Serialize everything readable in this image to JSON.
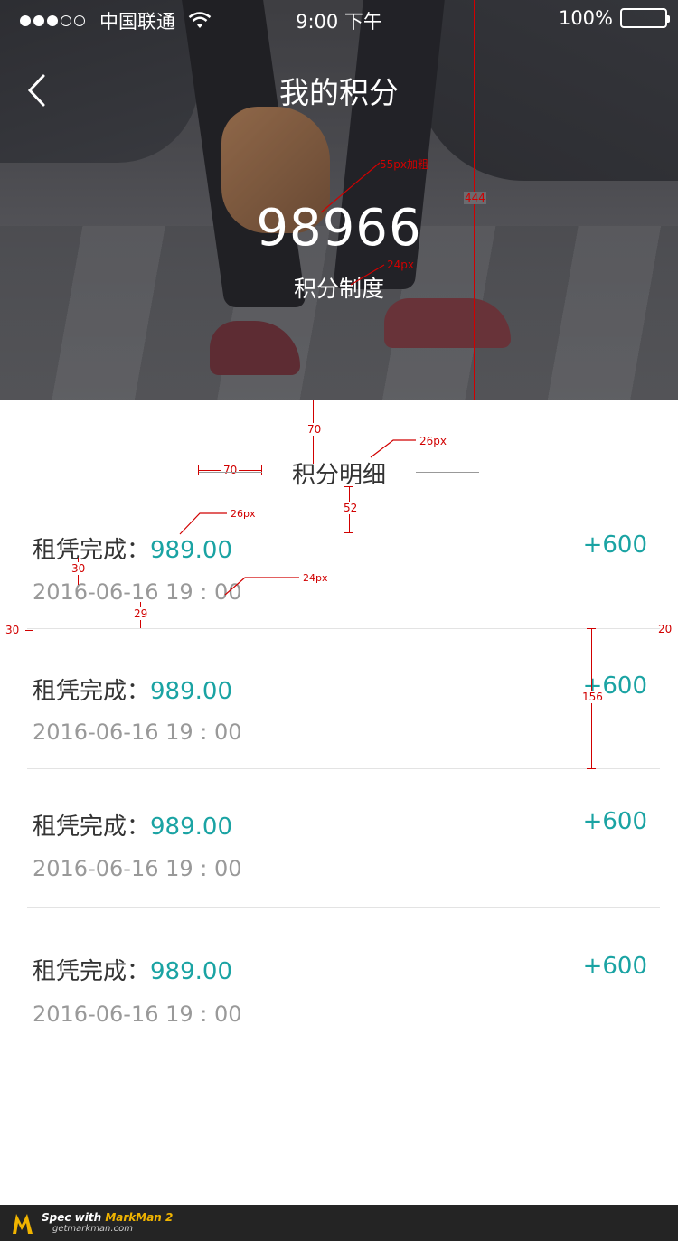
{
  "status_bar": {
    "carrier": "中国联通",
    "time": "9:00 下午",
    "battery": "100%"
  },
  "header": {
    "title": "我的积分",
    "points": "98966",
    "rules_link": "积分制度"
  },
  "section": {
    "title": "积分明细"
  },
  "records": [
    {
      "label": "租凭完成：",
      "amount": "989.00",
      "change": "+600",
      "datetime": "2016-06-16   19 : 00"
    },
    {
      "label": "租凭完成：",
      "amount": "989.00",
      "change": "+600",
      "datetime": "2016-06-16   19 : 00"
    },
    {
      "label": "租凭完成：",
      "amount": "989.00",
      "change": "+600",
      "datetime": "2016-06-16   19 : 00"
    },
    {
      "label": "租凭完成：",
      "amount": "989.00",
      "change": "+600",
      "datetime": "2016-06-16   19 : 00"
    }
  ],
  "annotations": {
    "a_444": "444",
    "a_55": "55px加粗",
    "a_24a": "24px",
    "a_70a": "70",
    "a_26a": "26px",
    "a_70b": "70",
    "a_52": "52",
    "a_26b": "26px",
    "a_30": "30",
    "a_24b": "24px",
    "a_29": "29",
    "a_30b": "30",
    "a_20": "20",
    "a_156": "156"
  },
  "footer": {
    "spec_text": "Spec with ",
    "brand": "MarkMan 2",
    "site": "getmarkman.com"
  },
  "colors": {
    "accent": "#1aa3a3",
    "annotation": "#d10000"
  }
}
